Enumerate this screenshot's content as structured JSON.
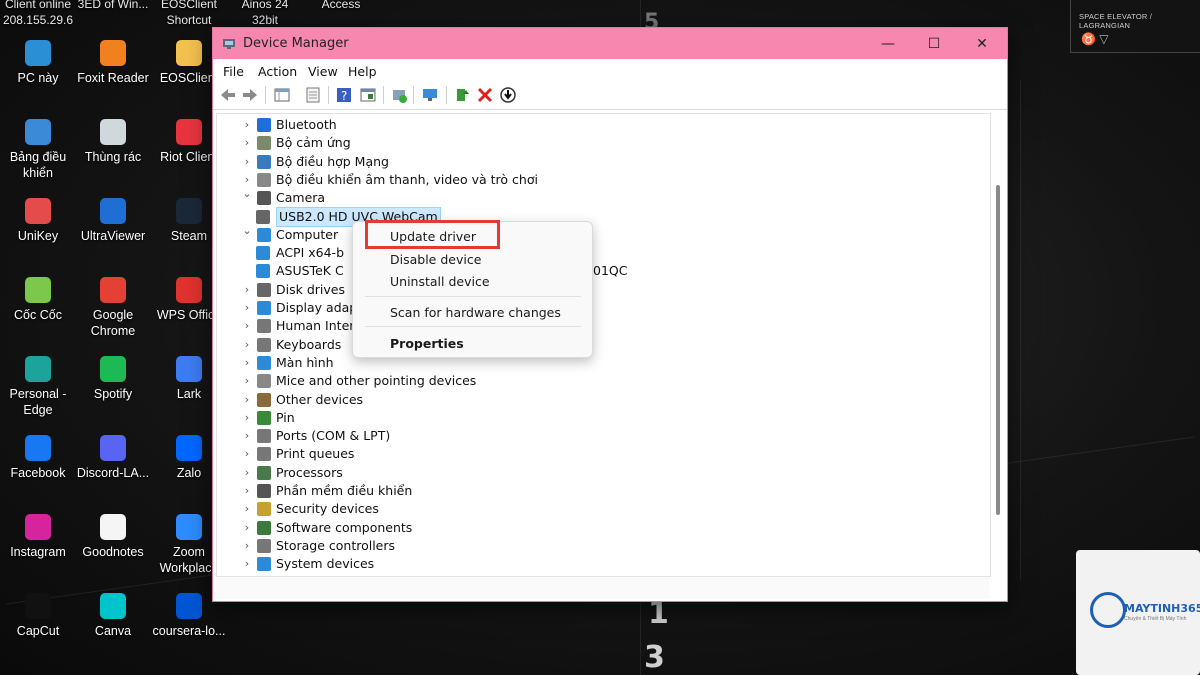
{
  "desktop": {
    "top_row": [
      {
        "label": "Client online\n208.155.29.6"
      },
      {
        "label": "3ED of Win..."
      },
      {
        "label": "EOSClient\nShortcut"
      },
      {
        "label": "Ainos 24\n32bit"
      },
      {
        "label": "Access"
      }
    ],
    "icons": [
      {
        "label": "PC này",
        "icon": "monitor-icon",
        "color": "#2b8fd6"
      },
      {
        "label": "Foxit Reader",
        "icon": "foxit-icon",
        "color": "#f0811e"
      },
      {
        "label": "EOSClient",
        "icon": "folder-icon",
        "color": "#f2c14e"
      },
      {
        "label": "Bảng điều khiển",
        "icon": "control-panel-icon",
        "color": "#3a8ad8"
      },
      {
        "label": "Thùng rác",
        "icon": "recycle-bin-icon",
        "color": "#cfd8dc"
      },
      {
        "label": "Riot Client",
        "icon": "riot-icon",
        "color": "#e8343e"
      },
      {
        "label": "UniKey",
        "icon": "unikey-icon",
        "color": "#e44c4c"
      },
      {
        "label": "UltraViewer",
        "icon": "ultraviewer-icon",
        "color": "#1f6ed4"
      },
      {
        "label": "Steam",
        "icon": "steam-icon",
        "color": "#1b2838"
      },
      {
        "label": "Cốc Cốc",
        "icon": "coccoc-icon",
        "color": "#7cc84a"
      },
      {
        "label": "Google Chrome",
        "icon": "chrome-icon",
        "color": "#e44134"
      },
      {
        "label": "WPS Office",
        "icon": "wps-icon",
        "color": "#e0322e"
      },
      {
        "label": "Personal - Edge",
        "icon": "edge-icon",
        "color": "#1ba39c"
      },
      {
        "label": "Spotify",
        "icon": "spotify-icon",
        "color": "#1db954"
      },
      {
        "label": "Lark",
        "icon": "lark-icon",
        "color": "#3d7cf2"
      },
      {
        "label": "Facebook",
        "icon": "facebook-icon",
        "color": "#1877f2"
      },
      {
        "label": "Discord-LA...",
        "icon": "discord-icon",
        "color": "#5865f2"
      },
      {
        "label": "Zalo",
        "icon": "zalo-icon",
        "color": "#0068ff"
      },
      {
        "label": "Instagram",
        "icon": "instagram-icon",
        "color": "#d6249f"
      },
      {
        "label": "Goodnotes",
        "icon": "goodnotes-icon",
        "color": "#f5f5f5"
      },
      {
        "label": "Zoom Workplace",
        "icon": "zoom-icon",
        "color": "#2d8cff"
      },
      {
        "label": "CapCut",
        "icon": "capcut-icon",
        "color": "#111111"
      },
      {
        "label": "Canva",
        "icon": "canva-icon",
        "color": "#00c4cc"
      },
      {
        "label": "coursera-lo...",
        "icon": "coursera-icon",
        "color": "#0056d2"
      }
    ],
    "info_panel": "SPACE ELEVATOR / LAGRANGIAN",
    "wall_numbers": [
      "5",
      "1",
      "3"
    ],
    "watermark": {
      "brand": "MAYTINH365",
      "tagline": "Chuyên & Thiết Bị Máy Tính"
    }
  },
  "window": {
    "title": "Device Manager",
    "menu": [
      "File",
      "Action",
      "View",
      "Help"
    ],
    "toolbar_icons": [
      "back-arrow-icon",
      "forward-arrow-icon",
      "properties-grid-icon",
      "show-hidden-icon",
      "help-icon",
      "driver-panel-icon",
      "add-hardware-icon",
      "monitor-scan-icon",
      "enable-device-icon",
      "uninstall-x-icon",
      "update-download-icon"
    ],
    "tree": [
      {
        "label": "Bluetooth",
        "state": "collapsed",
        "icon": "bluetooth-icon",
        "color": "#1e6fd9",
        "level": 1
      },
      {
        "label": "Bộ cảm ứng",
        "state": "collapsed",
        "icon": "sensor-icon",
        "color": "#7a8a6a",
        "level": 1
      },
      {
        "label": "Bộ điều hợp Mạng",
        "state": "collapsed",
        "icon": "network-adapter-icon",
        "color": "#3a7abf",
        "level": 1
      },
      {
        "label": "Bộ điều khiển âm thanh, video và trò chơi",
        "state": "collapsed",
        "icon": "speaker-icon",
        "color": "#888888",
        "level": 1
      },
      {
        "label": "Camera",
        "state": "expanded",
        "icon": "camera-icon",
        "color": "#555555",
        "level": 1
      },
      {
        "label": "USB2.0 HD UVC WebCam",
        "state": "leaf",
        "icon": "webcam-icon",
        "color": "#666666",
        "level": 2,
        "selected": true
      },
      {
        "label": "Computer",
        "state": "expanded",
        "icon": "computer-icon",
        "color": "#2d8ad6",
        "level": 1
      },
      {
        "label": "ACPI x64-b",
        "state": "leaf",
        "icon": "pc-icon",
        "color": "#2d8ad6",
        "level": 2
      },
      {
        "label": "ASUSTeK C",
        "suffix": "01QC",
        "state": "leaf",
        "icon": "pc-icon",
        "color": "#2d8ad6",
        "level": 2
      },
      {
        "label": "Disk drives",
        "state": "collapsed",
        "icon": "disk-icon",
        "color": "#666666",
        "level": 1
      },
      {
        "label": "Display adapt",
        "state": "collapsed",
        "icon": "display-icon",
        "color": "#2d8ad6",
        "level": 1
      },
      {
        "label": "Human Interfa",
        "state": "collapsed",
        "icon": "hid-icon",
        "color": "#777777",
        "level": 1
      },
      {
        "label": "Keyboards",
        "state": "collapsed",
        "icon": "keyboard-icon",
        "color": "#777777",
        "level": 1
      },
      {
        "label": "Màn hình",
        "state": "collapsed",
        "icon": "monitor-icon",
        "color": "#2d8ad6",
        "level": 1
      },
      {
        "label": "Mice and other pointing devices",
        "state": "collapsed",
        "icon": "mouse-icon",
        "color": "#888888",
        "level": 1
      },
      {
        "label": "Other devices",
        "state": "collapsed",
        "icon": "other-device-icon",
        "color": "#8a6a3a",
        "level": 1
      },
      {
        "label": "Pin",
        "state": "collapsed",
        "icon": "battery-icon",
        "color": "#3a8a3a",
        "level": 1
      },
      {
        "label": "Ports (COM & LPT)",
        "state": "collapsed",
        "icon": "port-icon",
        "color": "#777777",
        "level": 1
      },
      {
        "label": "Print queues",
        "state": "collapsed",
        "icon": "printer-icon",
        "color": "#777777",
        "level": 1
      },
      {
        "label": "Processors",
        "state": "collapsed",
        "icon": "processor-icon",
        "color": "#4a7a4a",
        "level": 1
      },
      {
        "label": "Phần mềm điều khiển",
        "state": "collapsed",
        "icon": "firmware-icon",
        "color": "#555555",
        "level": 1
      },
      {
        "label": "Security devices",
        "state": "collapsed",
        "icon": "security-icon",
        "color": "#c8a030",
        "level": 1
      },
      {
        "label": "Software components",
        "state": "collapsed",
        "icon": "software-component-icon",
        "color": "#3a7a3a",
        "level": 1
      },
      {
        "label": "Storage controllers",
        "state": "collapsed",
        "icon": "storage-controller-icon",
        "color": "#777777",
        "level": 1
      },
      {
        "label": "System devices",
        "state": "collapsed",
        "icon": "system-device-icon",
        "color": "#2d8ad6",
        "level": 1
      }
    ]
  },
  "context_menu": {
    "items": [
      {
        "label": "Update driver",
        "bold": false,
        "highlighted": true
      },
      {
        "label": "Disable device",
        "bold": false
      },
      {
        "label": "Uninstall device",
        "bold": false
      },
      {
        "label": "Scan for hardware changes",
        "bold": false
      },
      {
        "label": "Properties",
        "bold": true
      }
    ],
    "highlight_color": "#e53935"
  }
}
